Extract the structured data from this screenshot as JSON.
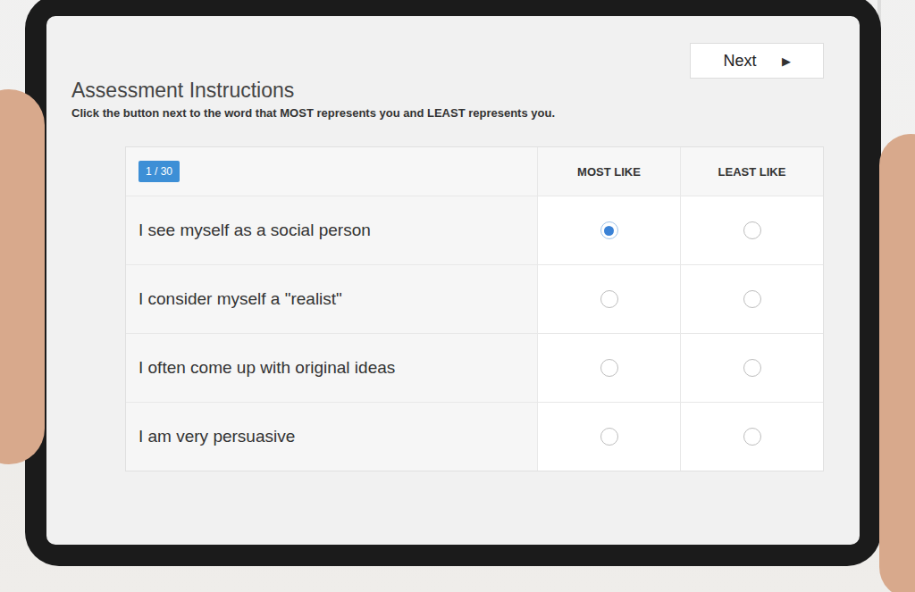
{
  "screen": {
    "title": "Assessment Instructions",
    "instructions": "Click the button next to the word that MOST represents you and LEAST represents you.",
    "next_button": {
      "label": "Next",
      "icon": "▶"
    },
    "progress": "1 / 30",
    "columns": [
      "MOST LIKE",
      "LEAST LIKE"
    ],
    "statements": [
      {
        "text": "I see myself as a social person",
        "most": {
          "selected": true
        },
        "least": {
          "selected": false
        }
      },
      {
        "text": "I consider myself a \"realist\"",
        "most": {
          "selected": false
        },
        "least": {
          "selected": false
        }
      },
      {
        "text": "I often come up with original ideas",
        "most": {
          "selected": false
        },
        "least": {
          "selected": false
        }
      },
      {
        "text": "I am very persuasive",
        "most": {
          "selected": false
        },
        "least": {
          "selected": false
        }
      }
    ]
  }
}
